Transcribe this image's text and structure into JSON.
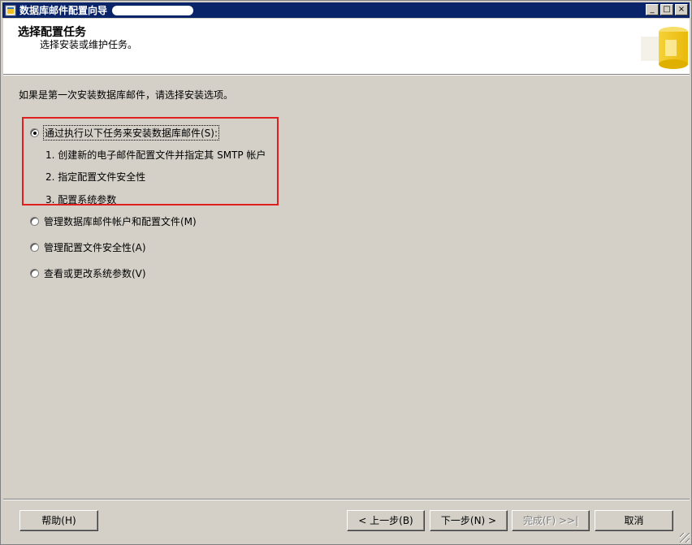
{
  "window": {
    "title": "数据库邮件配置向导",
    "controls": {
      "minimize": "_",
      "maximize": "□",
      "close": "×"
    }
  },
  "header": {
    "title": "选择配置任务",
    "subtitle": "选择安装或维护任务。",
    "logo_icon": "database-wizard-icon"
  },
  "main": {
    "intro": "如果是第一次安装数据库邮件，请选择安装选项。",
    "options": [
      {
        "label": "通过执行以下任务来安装数据库邮件(S):",
        "checked": true
      },
      {
        "label": "管理数据库邮件帐户和配置文件(M)",
        "checked": false
      },
      {
        "label": "管理配置文件安全性(A)",
        "checked": false
      },
      {
        "label": "查看或更改系统参数(V)",
        "checked": false
      }
    ],
    "steps": [
      "1. 创建新的电子邮件配置文件并指定其 SMTP 帐户",
      "2. 指定配置文件安全性",
      "3. 配置系统参数"
    ]
  },
  "footer": {
    "help": "帮助(H)",
    "back": "< 上一步(B)",
    "next": "下一步(N) >",
    "finish": "完成(F) >>|",
    "cancel": "取消"
  },
  "colors": {
    "titlebar": "#0a246a",
    "highlight_border": "#e02020",
    "face": "#d4d0c8"
  }
}
